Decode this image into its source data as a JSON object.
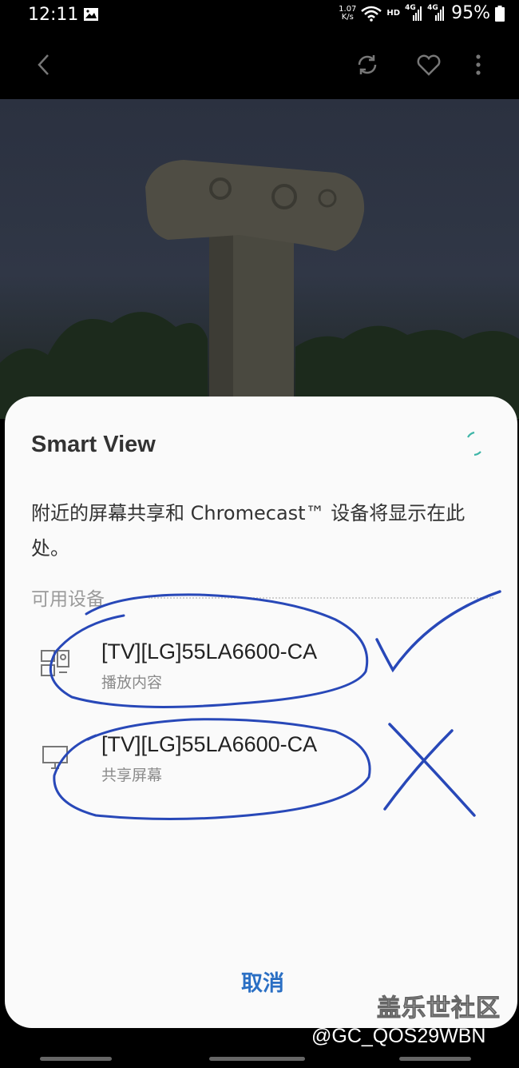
{
  "status_bar": {
    "time": "12:11",
    "net_speed_value": "1.07",
    "net_speed_unit": "K/s",
    "hd_label": "HD",
    "signal_1": "4G",
    "signal_2": "4G",
    "battery": "95%",
    "icons": [
      "gallery-icon",
      "wifi-icon",
      "signal-icon",
      "signal-icon",
      "battery-icon"
    ]
  },
  "top_bar": {
    "icons": [
      "back-icon",
      "rotate-icon",
      "heart-icon",
      "more-icon"
    ]
  },
  "dialog": {
    "title": "Smart View",
    "description": "附近的屏幕共享和 Chromecast™ 设备将显示在此处。",
    "section_label": "可用设备",
    "devices": [
      {
        "name": "[TV][LG]55LA6600-CA",
        "subtitle": "播放内容",
        "icon": "cast-content-icon"
      },
      {
        "name": "[TV][LG]55LA6600-CA",
        "subtitle": "共享屏幕",
        "icon": "screen-mirror-icon"
      }
    ],
    "cancel_label": "取消",
    "accent_color": "#2a6fc4"
  },
  "annotations": {
    "pen_color": "#2848b8",
    "marks": [
      "circle",
      "check-mark",
      "circle",
      "x-mark"
    ]
  },
  "watermark": {
    "site": "盖乐世社区",
    "user": "@GC_QOS29WBN"
  }
}
